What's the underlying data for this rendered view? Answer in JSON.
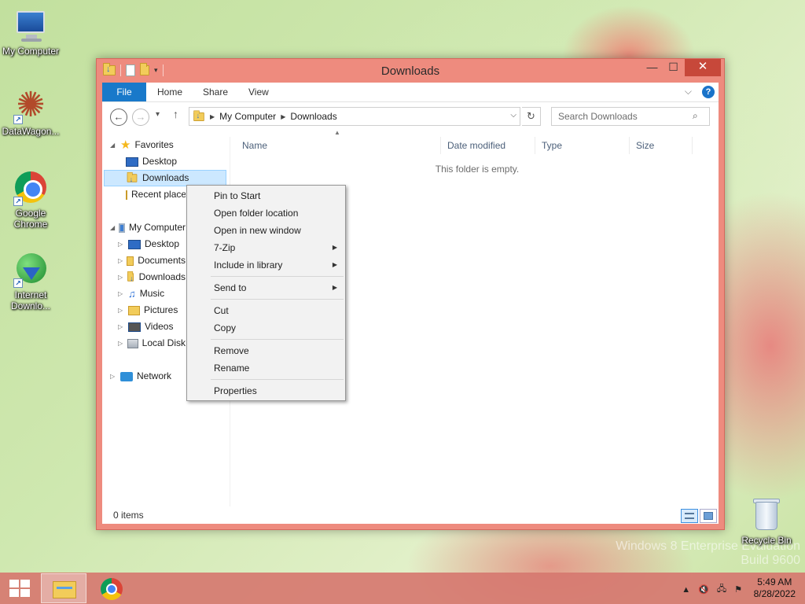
{
  "desktop": {
    "icons": [
      {
        "label": "My Computer",
        "icon": "computer-icon"
      },
      {
        "label": "DataWagon...",
        "icon": "datawagon-icon"
      },
      {
        "label": "Google Chrome",
        "icon": "chrome-icon"
      },
      {
        "label": "Internet Downlo...",
        "icon": "idm-icon"
      }
    ],
    "recycle_bin": {
      "label": "Recycle Bin",
      "icon": "recycle-bin-icon"
    },
    "watermark": {
      "line1": "Windows 8 Enterprise Evaluation",
      "line2": "Build 9600"
    }
  },
  "window": {
    "title": "Downloads",
    "controls": {
      "minimize": "—",
      "maximize": "☐",
      "close": "✕"
    },
    "ribbon": {
      "tabs": [
        "File",
        "Home",
        "Share",
        "View"
      ]
    },
    "nav": {
      "back": "←",
      "forward": "→",
      "up": "↑",
      "recent_dropdown": "▾",
      "breadcrumb": [
        "My Computer",
        "Downloads"
      ],
      "search_placeholder": "Search Downloads"
    },
    "tree": {
      "favorites": {
        "label": "Favorites",
        "items": [
          "Desktop",
          "Downloads",
          "Recent places"
        ]
      },
      "computer": {
        "label": "My Computer",
        "items": [
          "Desktop",
          "Documents",
          "Downloads",
          "Music",
          "Pictures",
          "Videos",
          "Local Disk"
        ]
      },
      "network": {
        "label": "Network"
      }
    },
    "columns": [
      "Name",
      "Date modified",
      "Type",
      "Size"
    ],
    "empty_message": "This folder is empty.",
    "status": "0 items"
  },
  "context_menu": {
    "groups": [
      [
        {
          "label": "Pin to Start",
          "submenu": false
        },
        {
          "label": "Open folder location",
          "submenu": false
        },
        {
          "label": "Open in new window",
          "submenu": false
        },
        {
          "label": "7-Zip",
          "submenu": true
        },
        {
          "label": "Include in library",
          "submenu": true
        }
      ],
      [
        {
          "label": "Send to",
          "submenu": true
        }
      ],
      [
        {
          "label": "Cut",
          "submenu": false
        },
        {
          "label": "Copy",
          "submenu": false
        }
      ],
      [
        {
          "label": "Remove",
          "submenu": false
        },
        {
          "label": "Rename",
          "submenu": false
        }
      ],
      [
        {
          "label": "Properties",
          "submenu": false
        }
      ]
    ]
  },
  "taskbar": {
    "apps": [
      "File Explorer",
      "Google Chrome"
    ],
    "clock": {
      "time": "5:49 AM",
      "date": "8/28/2022"
    }
  },
  "colors": {
    "window_frame": "#ee8b7e",
    "close_button": "#c7483a",
    "file_tab": "#1979ca",
    "selection": "#cce8ff",
    "taskbar": "#d67870"
  }
}
